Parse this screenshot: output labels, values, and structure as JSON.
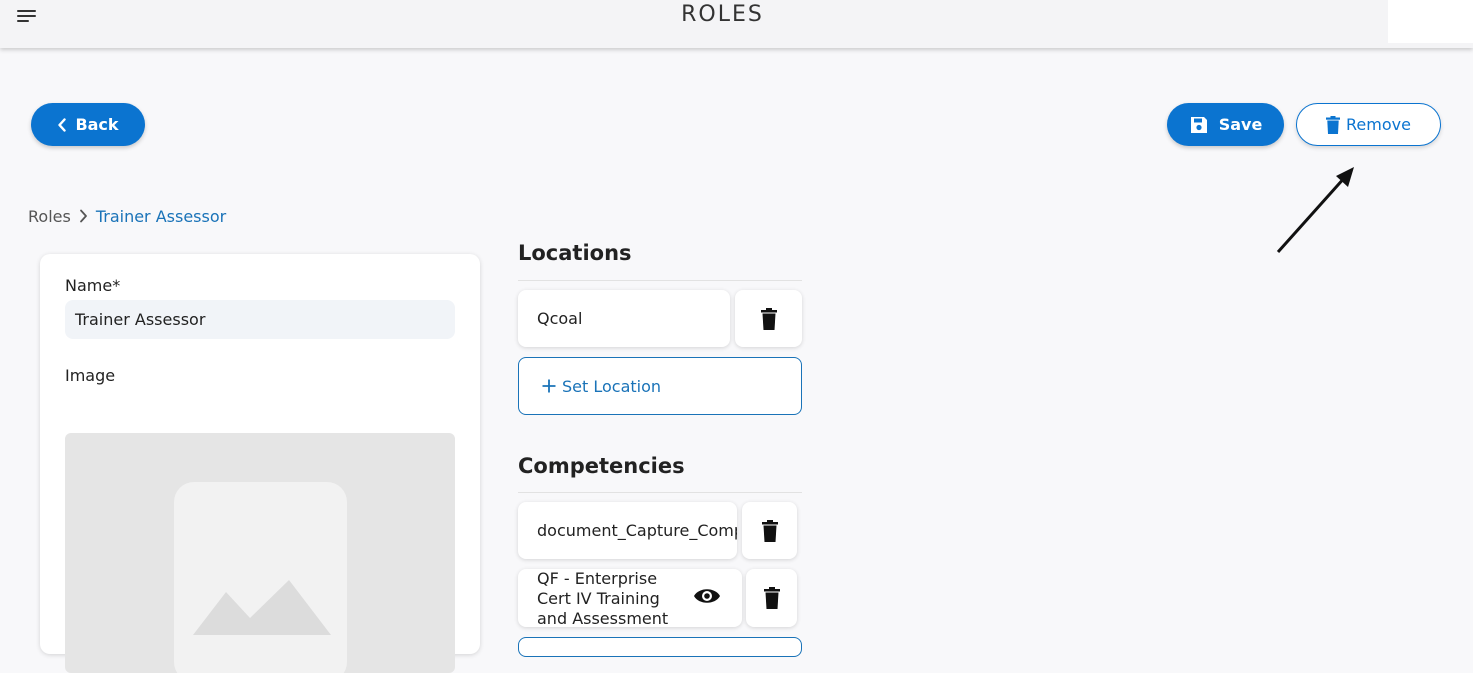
{
  "header": {
    "title": "ROLES",
    "menu_icon": "hamburger-menu-icon"
  },
  "actions": {
    "back_label": "Back",
    "save_label": "Save",
    "remove_label": "Remove"
  },
  "breadcrumb": {
    "root": "Roles",
    "current": "Trainer Assessor"
  },
  "form": {
    "name_label": "Name*",
    "name_value": "Trainer Assessor",
    "image_label": "Image"
  },
  "locations": {
    "title": "Locations",
    "items": [
      {
        "label": "Qcoal"
      }
    ],
    "add_label": "Set Location"
  },
  "competencies": {
    "title": "Competencies",
    "items": [
      {
        "label": "document_Capture_Competency"
      },
      {
        "label": "QF - Enterprise Cert IV Training and Assessment"
      }
    ]
  },
  "colors": {
    "primary": "#0b74d0",
    "link": "#1a73b8"
  }
}
